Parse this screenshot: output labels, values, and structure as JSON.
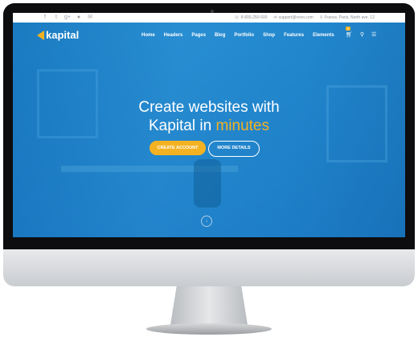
{
  "topbar": {
    "social_icons": [
      "facebook-icon",
      "twitter-icon",
      "google-plus-icon",
      "flickr-icon",
      "email-icon"
    ],
    "social_glyphs": [
      "f",
      "t",
      "g+",
      "●",
      "✉"
    ],
    "phone": "8-800-250-500",
    "email": "support@rvivo.com",
    "address": "France, Paris, North ave. 12"
  },
  "nav": {
    "logo_text": "kapital",
    "items": [
      "Home",
      "Headers",
      "Pages",
      "Blog",
      "Portfolio",
      "Shop",
      "Features",
      "Elements"
    ],
    "cart_count": "0"
  },
  "hero": {
    "title_line1": "Create websites with",
    "title_line2_prefix": "Kapital in ",
    "title_line2_accent": "minutes",
    "primary_button": "CREATE ACCOUNT",
    "secondary_button": "MORE DETAILS"
  },
  "colors": {
    "accent": "#f4b222",
    "hero_blue": "#1f7fc4"
  }
}
